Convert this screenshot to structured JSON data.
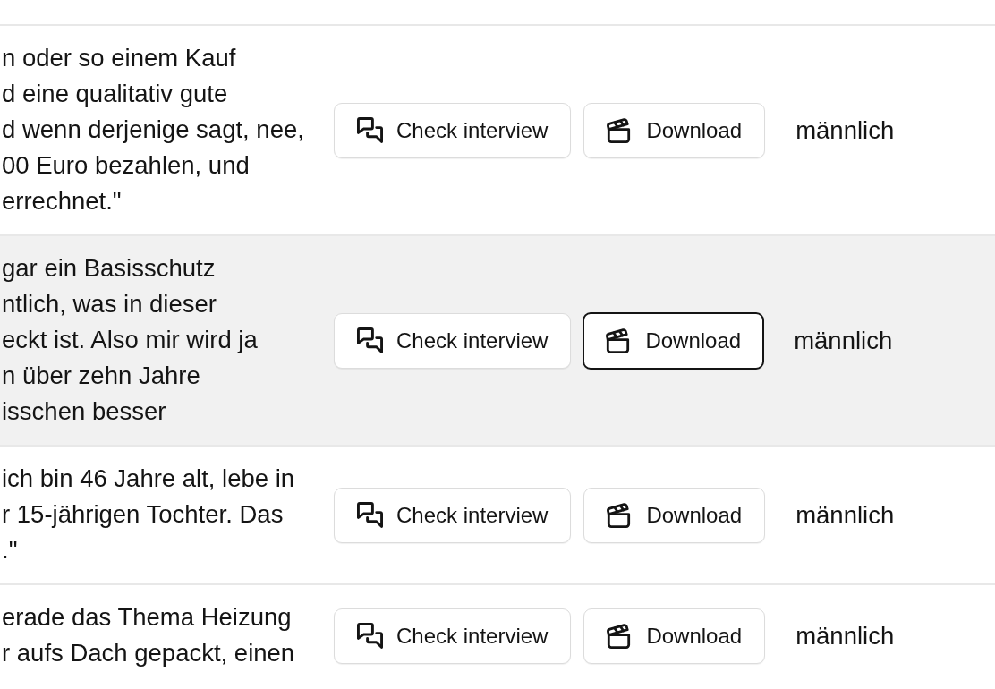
{
  "rows": [
    {
      "quote": "n oder so einem Kauf\nd eine qualitativ gute\nd wenn derjenige sagt, nee,\n00 Euro bezahlen, und\nerrechnet.\"",
      "highlighted": false,
      "actions": [
        {
          "kind": "interview",
          "label": "Check interview",
          "focused": false
        },
        {
          "kind": "download",
          "label": "Download",
          "focused": false
        }
      ],
      "gender": "männlich"
    },
    {
      "quote": "gar ein Basisschutz\nntlich, was in dieser\neckt ist. Also mir wird ja\nn über zehn Jahre\nisschen besser",
      "highlighted": true,
      "actions": [
        {
          "kind": "interview",
          "label": "Check interview",
          "focused": false
        },
        {
          "kind": "download",
          "label": "Download",
          "focused": true
        }
      ],
      "gender": "männlich"
    },
    {
      "quote": "ich bin 46 Jahre alt, lebe in\nr 15-jährigen Tochter. Das\n.\"",
      "highlighted": false,
      "actions": [
        {
          "kind": "interview",
          "label": "Check interview",
          "focused": false
        },
        {
          "kind": "download",
          "label": "Download",
          "focused": false
        }
      ],
      "gender": "männlich"
    },
    {
      "quote": "erade das Thema Heizung\nr aufs Dach gepackt, einen",
      "highlighted": false,
      "actions": [
        {
          "kind": "interview",
          "label": "Check interview",
          "focused": false
        },
        {
          "kind": "download",
          "label": "Download",
          "focused": false
        }
      ],
      "gender": "männlich"
    }
  ]
}
